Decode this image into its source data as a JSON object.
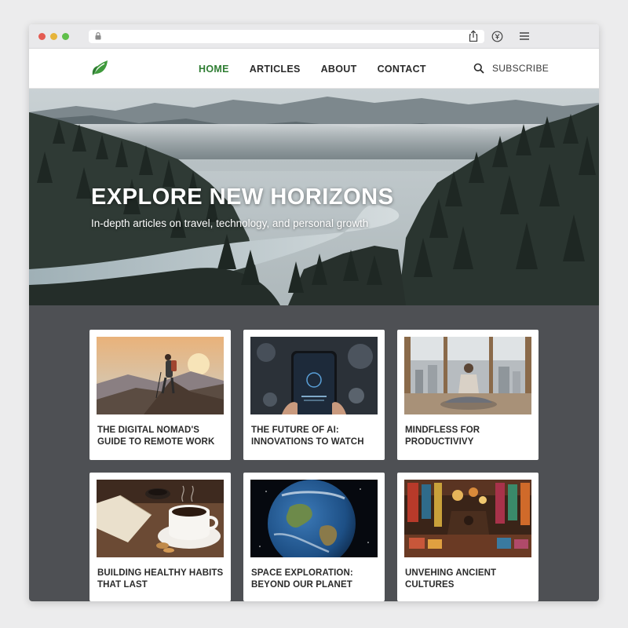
{
  "nav": {
    "items": [
      {
        "label": "HOME",
        "active": true
      },
      {
        "label": "ARTICLES",
        "active": false
      },
      {
        "label": "ABOUT",
        "active": false
      },
      {
        "label": "CONTACT",
        "active": false
      }
    ],
    "subscribe_label": "SUBSCRIBE"
  },
  "hero": {
    "title": "EXPLORE NEW HORIZONS",
    "subtitle": "In-depth articles on travel, technology, and personal growth"
  },
  "articles": [
    {
      "title": "THE DIGITAL NOMAD'S GUIDE TO REMOTE WORK"
    },
    {
      "title": "THE FUTURE OF AI: INNOVATIONS TO WATCH"
    },
    {
      "title": "MINDFLESS FOR PRODUCTIVIVY"
    },
    {
      "title": "BUILDING HEALTHY HABITS THAT LAST"
    },
    {
      "title": "SPACE EXPLORATION: BEYOND OUR PLANET"
    },
    {
      "title": "UNVEHING ANCIENT CULTURES"
    }
  ],
  "colors": {
    "accent": "#2e7d32",
    "content_bg": "#4e5054",
    "chrome_bg": "#e9e9eb"
  },
  "icons": [
    "lock-icon",
    "share-icon",
    "wallet-icon",
    "menu-icon",
    "leaf-logo-icon",
    "search-icon"
  ]
}
